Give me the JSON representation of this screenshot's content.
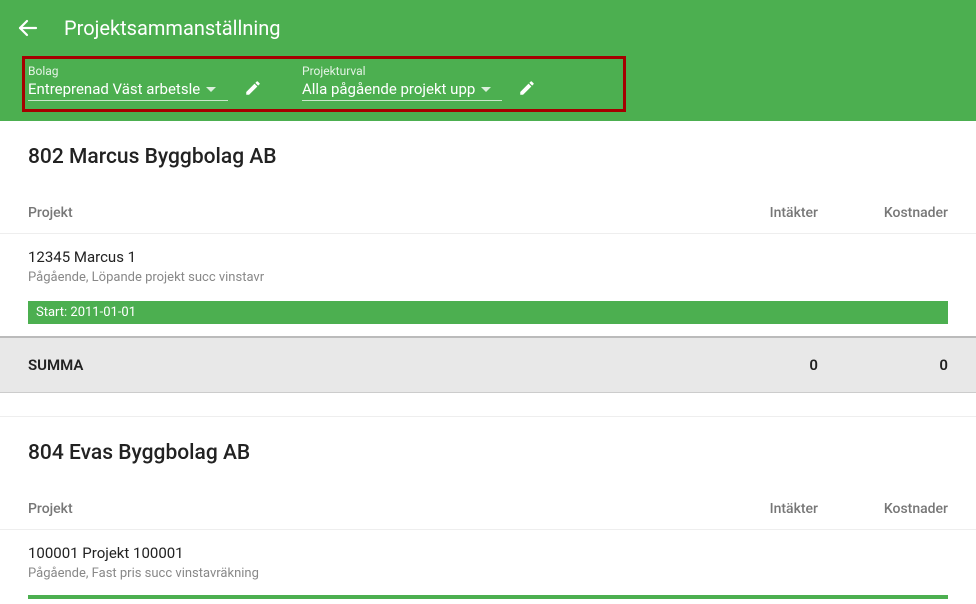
{
  "header": {
    "title": "Projektsammanställning",
    "filters": {
      "bolag": {
        "label": "Bolag",
        "value": "Entreprenad Väst arbetsle"
      },
      "projekturval": {
        "label": "Projekturval",
        "value": "Alla pågående projekt upp"
      }
    }
  },
  "sections": [
    {
      "title": "802 Marcus Byggbolag AB",
      "columns": {
        "project": "Projekt",
        "intakter": "Intäkter",
        "kostnader": "Kostnader"
      },
      "rows": [
        {
          "name": "12345 Marcus 1",
          "sub": "Pågående, Löpande projekt succ vinstavr",
          "bar": "Start: 2011-01-01"
        }
      ],
      "summa": {
        "label": "SUMMA",
        "intakter": "0",
        "kostnader": "0"
      }
    },
    {
      "title": "804 Evas Byggbolag AB",
      "columns": {
        "project": "Projekt",
        "intakter": "Intäkter",
        "kostnader": "Kostnader"
      },
      "rows": [
        {
          "name": "100001 Projekt 100001",
          "sub": "Pågående, Fast pris succ vinstavräkning"
        }
      ]
    }
  ]
}
